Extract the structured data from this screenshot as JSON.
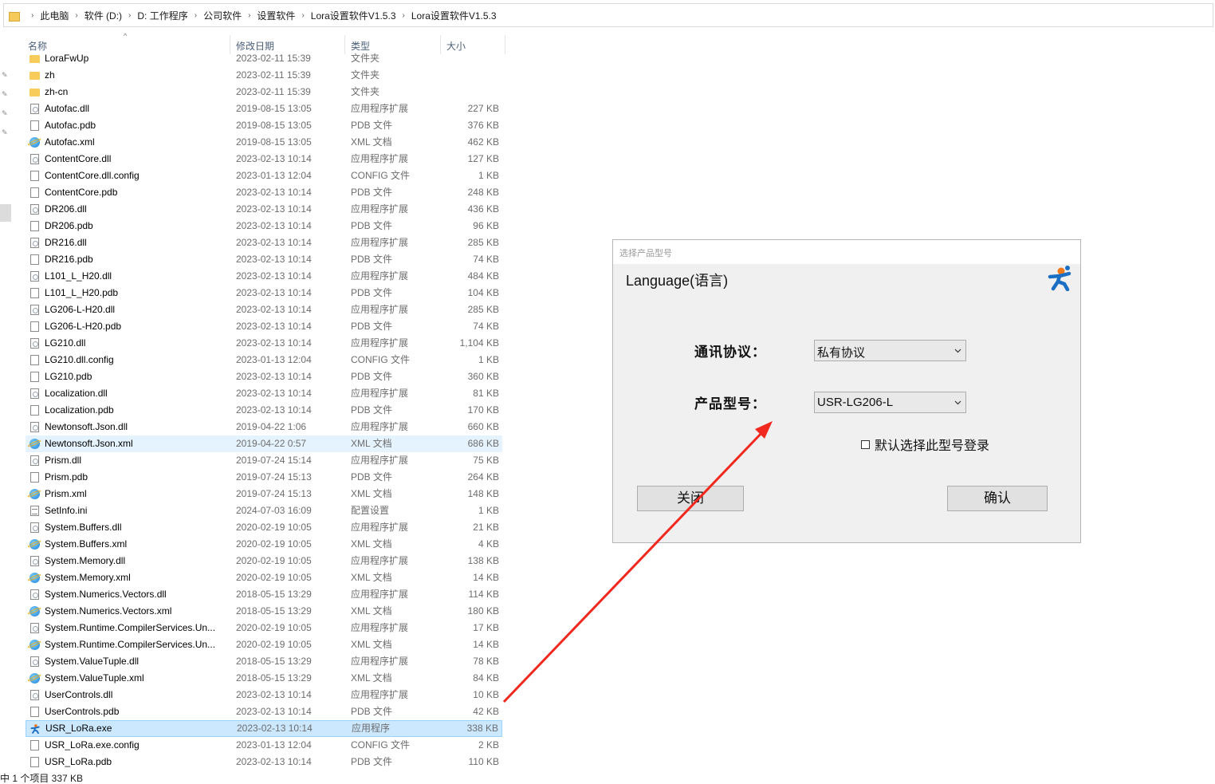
{
  "breadcrumbs": [
    "此电脑",
    "软件 (D:)",
    "D:  工作程序",
    "公司软件",
    "设置软件",
    "Lora设置软件V1.5.3",
    "Lora设置软件V1.5.3"
  ],
  "columns": {
    "name": "名称",
    "date": "修改日期",
    "type": "类型",
    "size": "大小"
  },
  "files": [
    {
      "name": "LoraFwUp",
      "date": "2023-02-11 15:39",
      "type": "文件夹",
      "size": "",
      "icon": "folder-icon"
    },
    {
      "name": "zh",
      "date": "2023-02-11 15:39",
      "type": "文件夹",
      "size": "",
      "icon": "folder-icon"
    },
    {
      "name": "zh-cn",
      "date": "2023-02-11 15:39",
      "type": "文件夹",
      "size": "",
      "icon": "folder-icon"
    },
    {
      "name": "Autofac.dll",
      "date": "2019-08-15 13:05",
      "type": "应用程序扩展",
      "size": "227 KB",
      "icon": "dll-icon"
    },
    {
      "name": "Autofac.pdb",
      "date": "2019-08-15 13:05",
      "type": "PDB 文件",
      "size": "376 KB",
      "icon": "file-icon"
    },
    {
      "name": "Autofac.xml",
      "date": "2019-08-15 13:05",
      "type": "XML 文档",
      "size": "462 KB",
      "icon": "xml-icon"
    },
    {
      "name": "ContentCore.dll",
      "date": "2023-02-13 10:14",
      "type": "应用程序扩展",
      "size": "127 KB",
      "icon": "dll-icon"
    },
    {
      "name": "ContentCore.dll.config",
      "date": "2023-01-13 12:04",
      "type": "CONFIG 文件",
      "size": "1 KB",
      "icon": "file-icon"
    },
    {
      "name": "ContentCore.pdb",
      "date": "2023-02-13 10:14",
      "type": "PDB 文件",
      "size": "248 KB",
      "icon": "file-icon"
    },
    {
      "name": "DR206.dll",
      "date": "2023-02-13 10:14",
      "type": "应用程序扩展",
      "size": "436 KB",
      "icon": "dll-icon"
    },
    {
      "name": "DR206.pdb",
      "date": "2023-02-13 10:14",
      "type": "PDB 文件",
      "size": "96 KB",
      "icon": "file-icon"
    },
    {
      "name": "DR216.dll",
      "date": "2023-02-13 10:14",
      "type": "应用程序扩展",
      "size": "285 KB",
      "icon": "dll-icon"
    },
    {
      "name": "DR216.pdb",
      "date": "2023-02-13 10:14",
      "type": "PDB 文件",
      "size": "74 KB",
      "icon": "file-icon"
    },
    {
      "name": "L101_L_H20.dll",
      "date": "2023-02-13 10:14",
      "type": "应用程序扩展",
      "size": "484 KB",
      "icon": "dll-icon"
    },
    {
      "name": "L101_L_H20.pdb",
      "date": "2023-02-13 10:14",
      "type": "PDB 文件",
      "size": "104 KB",
      "icon": "file-icon"
    },
    {
      "name": "LG206-L-H20.dll",
      "date": "2023-02-13 10:14",
      "type": "应用程序扩展",
      "size": "285 KB",
      "icon": "dll-icon"
    },
    {
      "name": "LG206-L-H20.pdb",
      "date": "2023-02-13 10:14",
      "type": "PDB 文件",
      "size": "74 KB",
      "icon": "file-icon"
    },
    {
      "name": "LG210.dll",
      "date": "2023-02-13 10:14",
      "type": "应用程序扩展",
      "size": "1,104 KB",
      "icon": "dll-icon"
    },
    {
      "name": "LG210.dll.config",
      "date": "2023-01-13 12:04",
      "type": "CONFIG 文件",
      "size": "1 KB",
      "icon": "file-icon"
    },
    {
      "name": "LG210.pdb",
      "date": "2023-02-13 10:14",
      "type": "PDB 文件",
      "size": "360 KB",
      "icon": "file-icon"
    },
    {
      "name": "Localization.dll",
      "date": "2023-02-13 10:14",
      "type": "应用程序扩展",
      "size": "81 KB",
      "icon": "dll-icon"
    },
    {
      "name": "Localization.pdb",
      "date": "2023-02-13 10:14",
      "type": "PDB 文件",
      "size": "170 KB",
      "icon": "file-icon"
    },
    {
      "name": "Newtonsoft.Json.dll",
      "date": "2019-04-22 1:06",
      "type": "应用程序扩展",
      "size": "660 KB",
      "icon": "dll-icon"
    },
    {
      "name": "Newtonsoft.Json.xml",
      "date": "2019-04-22 0:57",
      "type": "XML 文档",
      "size": "686 KB",
      "icon": "xml-icon",
      "state": "hover"
    },
    {
      "name": "Prism.dll",
      "date": "2019-07-24 15:14",
      "type": "应用程序扩展",
      "size": "75 KB",
      "icon": "dll-icon"
    },
    {
      "name": "Prism.pdb",
      "date": "2019-07-24 15:13",
      "type": "PDB 文件",
      "size": "264 KB",
      "icon": "file-icon"
    },
    {
      "name": "Prism.xml",
      "date": "2019-07-24 15:13",
      "type": "XML 文档",
      "size": "148 KB",
      "icon": "xml-icon"
    },
    {
      "name": "SetInfo.ini",
      "date": "2024-07-03 16:09",
      "type": "配置设置",
      "size": "1 KB",
      "icon": "ini-icon"
    },
    {
      "name": "System.Buffers.dll",
      "date": "2020-02-19 10:05",
      "type": "应用程序扩展",
      "size": "21 KB",
      "icon": "dll-icon"
    },
    {
      "name": "System.Buffers.xml",
      "date": "2020-02-19 10:05",
      "type": "XML 文档",
      "size": "4 KB",
      "icon": "xml-icon"
    },
    {
      "name": "System.Memory.dll",
      "date": "2020-02-19 10:05",
      "type": "应用程序扩展",
      "size": "138 KB",
      "icon": "dll-icon"
    },
    {
      "name": "System.Memory.xml",
      "date": "2020-02-19 10:05",
      "type": "XML 文档",
      "size": "14 KB",
      "icon": "xml-icon"
    },
    {
      "name": "System.Numerics.Vectors.dll",
      "date": "2018-05-15 13:29",
      "type": "应用程序扩展",
      "size": "114 KB",
      "icon": "dll-icon"
    },
    {
      "name": "System.Numerics.Vectors.xml",
      "date": "2018-05-15 13:29",
      "type": "XML 文档",
      "size": "180 KB",
      "icon": "xml-icon"
    },
    {
      "name": "System.Runtime.CompilerServices.Un...",
      "date": "2020-02-19 10:05",
      "type": "应用程序扩展",
      "size": "17 KB",
      "icon": "dll-icon"
    },
    {
      "name": "System.Runtime.CompilerServices.Un...",
      "date": "2020-02-19 10:05",
      "type": "XML 文档",
      "size": "14 KB",
      "icon": "xml-icon"
    },
    {
      "name": "System.ValueTuple.dll",
      "date": "2018-05-15 13:29",
      "type": "应用程序扩展",
      "size": "78 KB",
      "icon": "dll-icon"
    },
    {
      "name": "System.ValueTuple.xml",
      "date": "2018-05-15 13:29",
      "type": "XML 文档",
      "size": "84 KB",
      "icon": "xml-icon"
    },
    {
      "name": "UserControls.dll",
      "date": "2023-02-13 10:14",
      "type": "应用程序扩展",
      "size": "10 KB",
      "icon": "dll-icon"
    },
    {
      "name": "UserControls.pdb",
      "date": "2023-02-13 10:14",
      "type": "PDB 文件",
      "size": "42 KB",
      "icon": "file-icon"
    },
    {
      "name": "USR_LoRa.exe",
      "date": "2023-02-13 10:14",
      "type": "应用程序",
      "size": "338 KB",
      "icon": "usr-logo-icon",
      "state": "selected"
    },
    {
      "name": "USR_LoRa.exe.config",
      "date": "2023-01-13 12:04",
      "type": "CONFIG 文件",
      "size": "2 KB",
      "icon": "file-icon"
    },
    {
      "name": "USR_LoRa.pdb",
      "date": "2023-02-13 10:14",
      "type": "PDB 文件",
      "size": "110 KB",
      "icon": "file-icon"
    }
  ],
  "status": {
    "text": "中 1 个项目  337 KB"
  },
  "dialog": {
    "title": "选择产品型号",
    "language_label": "Language(语言)",
    "protocol_label": "通讯协议：",
    "protocol_value": "私有协议",
    "model_label": "产品型号：",
    "model_value": "USR-LG206-L",
    "remember_label": "默认选择此型号登录",
    "remember_checked": false,
    "close_label": "关闭",
    "ok_label": "确认"
  },
  "colors": {
    "arrow": "#f0281e",
    "selected_row": "#cce8ff",
    "hover_row": "#e5f3ff",
    "logo_blue": "#1a6fc4",
    "logo_orange": "#f07a1a"
  }
}
